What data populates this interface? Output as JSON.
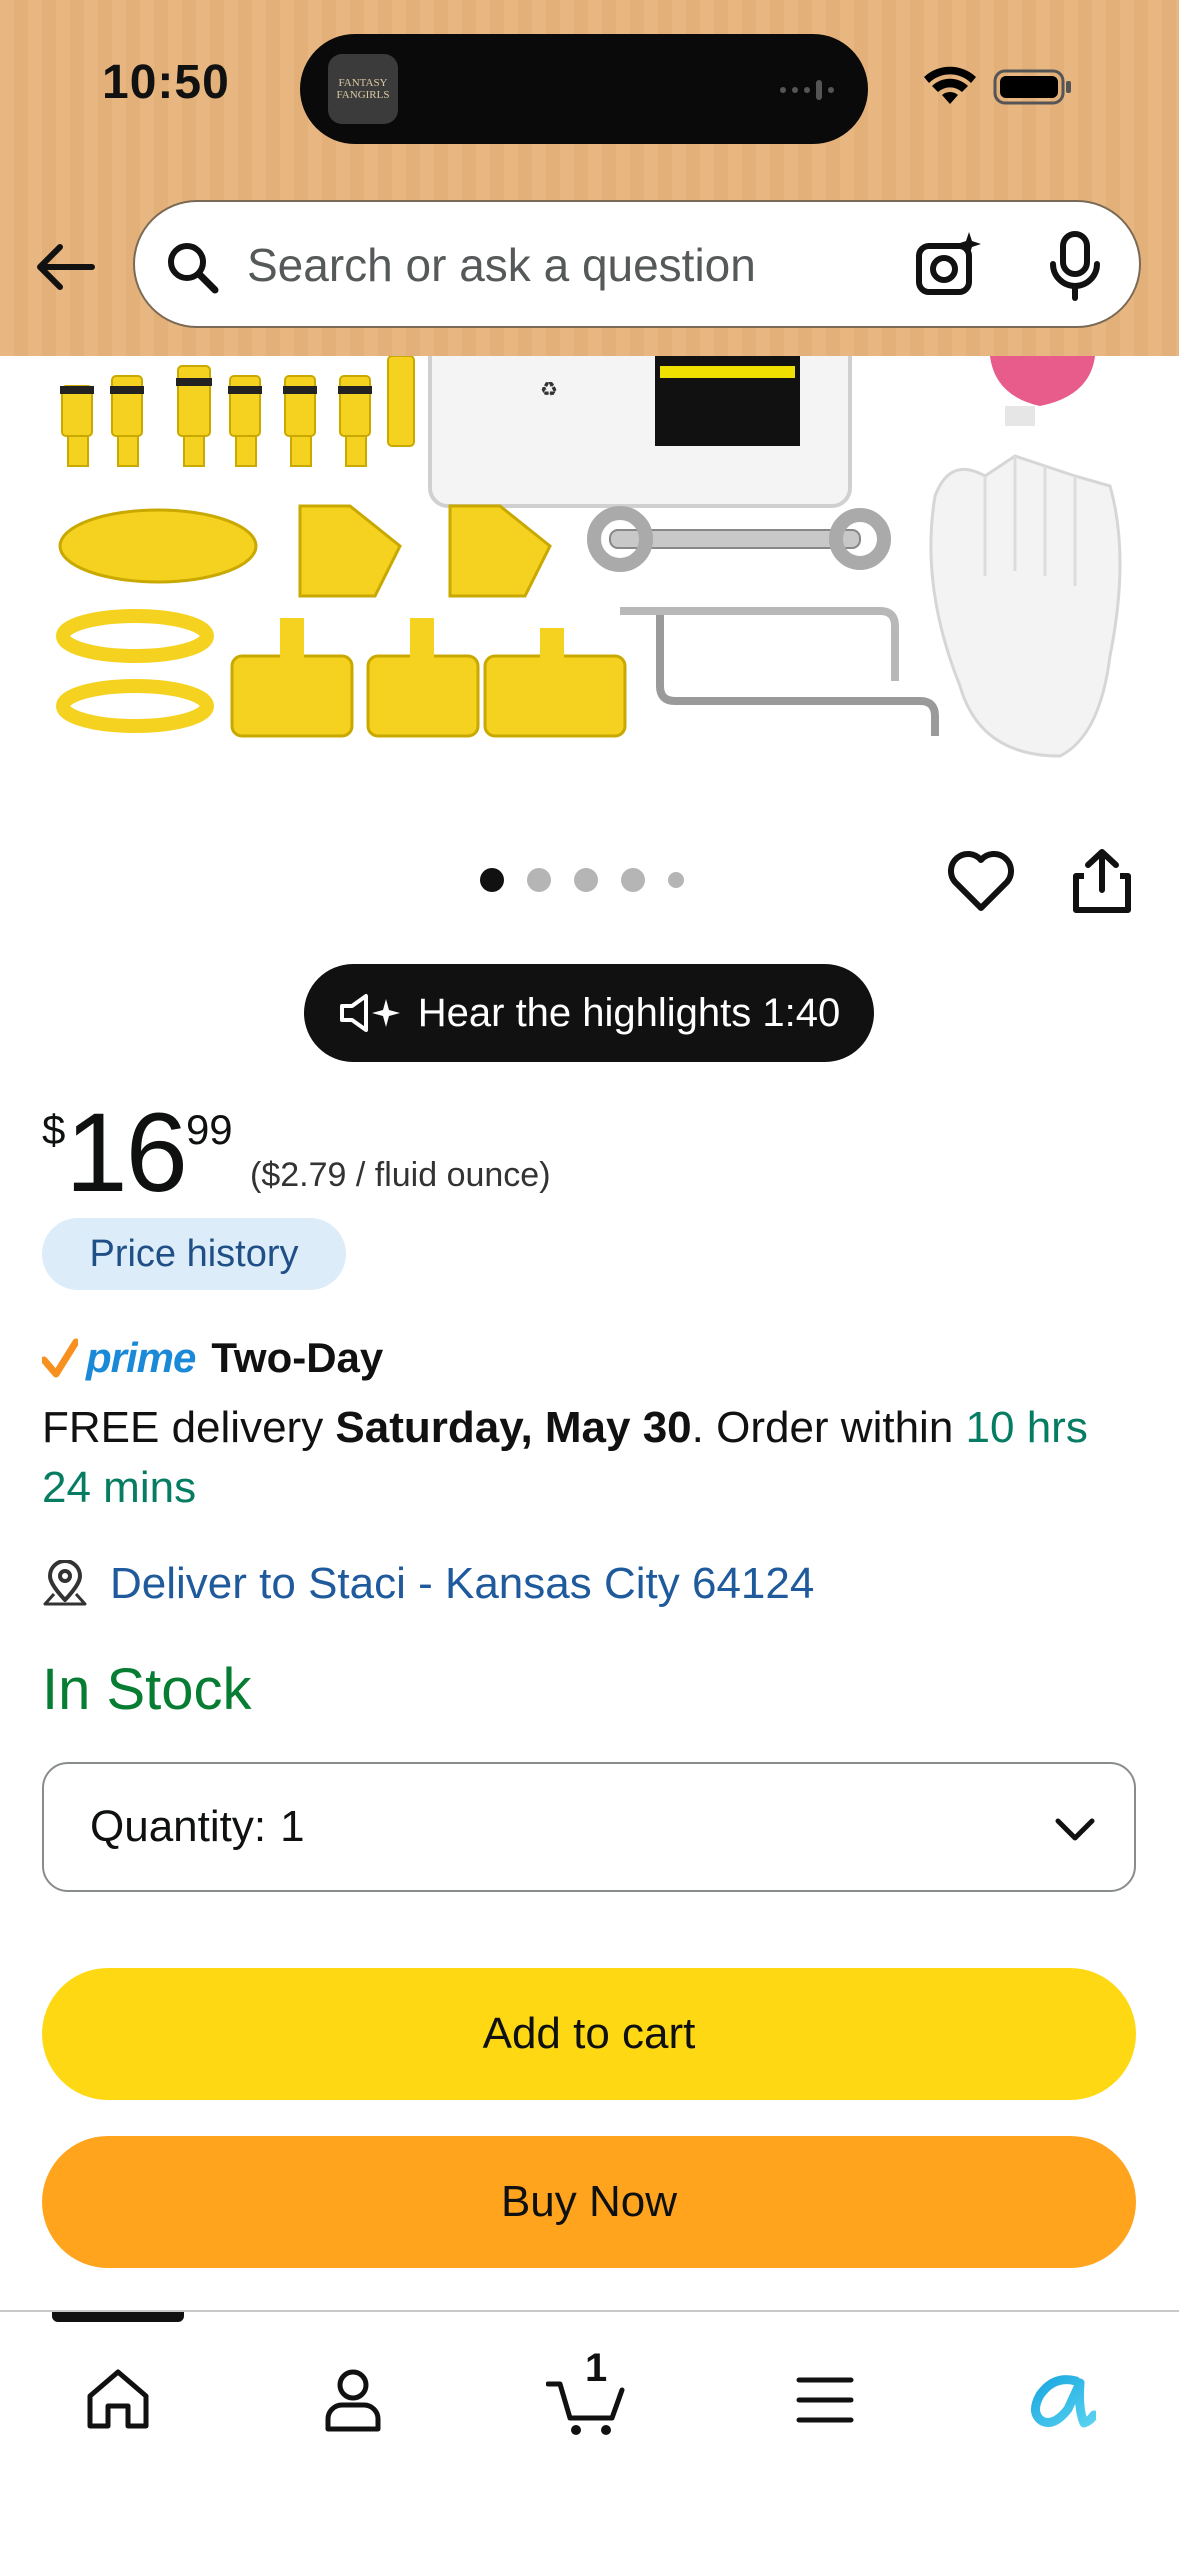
{
  "status_bar": {
    "time": "10:50",
    "island_app_label": "FANTASY FANGIRLS"
  },
  "search": {
    "placeholder": "Search or ask a question"
  },
  "gallery": {
    "dots": 5,
    "active_index": 0
  },
  "audio": {
    "label": "Hear the highlights 1:40"
  },
  "price": {
    "symbol": "$",
    "whole": "16",
    "fraction": "99",
    "unit_price": "($2.79 / fluid ounce)"
  },
  "price_history_label": "Price history",
  "prime": {
    "word": "prime",
    "speed": "Two-Day"
  },
  "delivery": {
    "prefix": "FREE delivery ",
    "date": "Saturday, May 30",
    "middle": ". Order within ",
    "countdown": "10 hrs 24 mins"
  },
  "deliver_to": "Deliver to Staci - Kansas City 64124",
  "stock_status": "In Stock",
  "quantity": {
    "label": "Quantity:",
    "value": "1"
  },
  "buttons": {
    "add_to_cart": "Add to cart",
    "buy_now": "Buy Now"
  },
  "bottom_nav": {
    "cart_count": "1"
  },
  "colors": {
    "header_bg": "#e8b781",
    "add_to_cart": "#ffd814",
    "buy_now": "#ffa41c",
    "in_stock": "#067d32",
    "link": "#1f5a9c",
    "prime_blue": "#1a8ad8",
    "prime_check": "#f7901e"
  }
}
